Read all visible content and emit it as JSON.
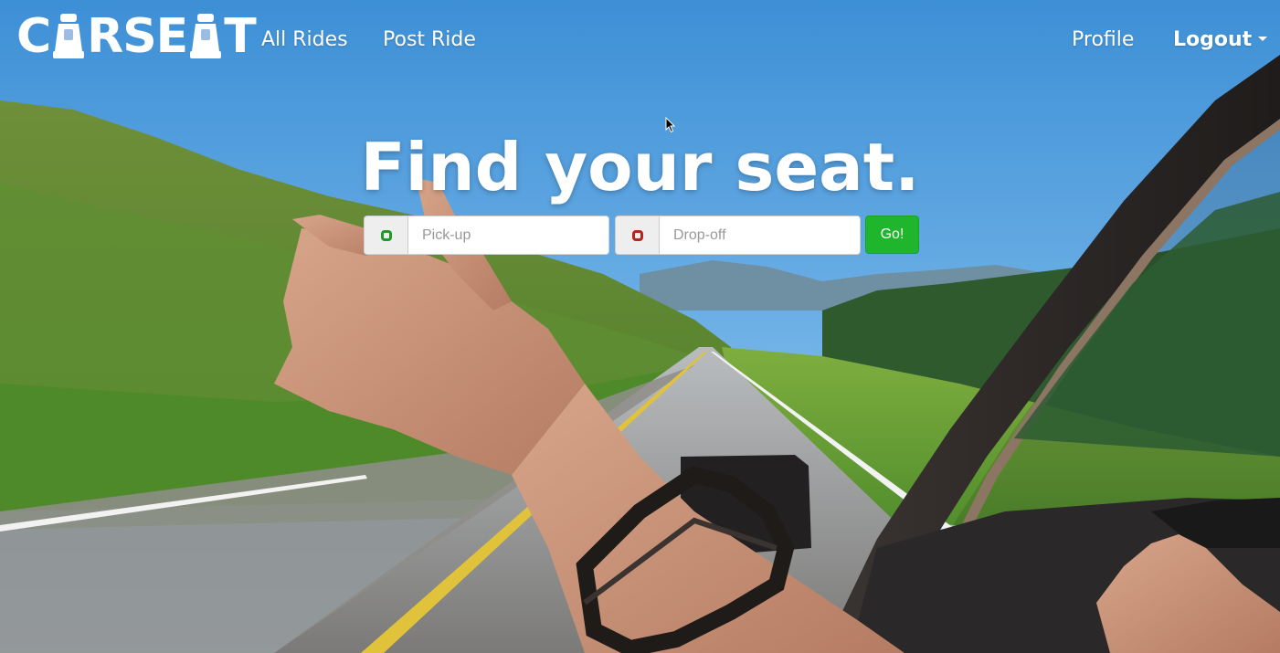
{
  "brand": {
    "name": "CARSEAT",
    "prefix": "C",
    "middle": "RSE",
    "suffix": "T"
  },
  "nav": {
    "links": [
      {
        "label": "All Rides"
      },
      {
        "label": "Post Ride"
      }
    ],
    "profile_label": "Profile",
    "logout_label": "Logout"
  },
  "hero": {
    "title": "Find your seat."
  },
  "search": {
    "pickup": {
      "placeholder": "Pick-up",
      "value": "",
      "icon": "pickup-marker-icon",
      "icon_color": "#1e9a2a"
    },
    "dropoff": {
      "placeholder": "Drop-off",
      "value": "",
      "icon": "dropoff-marker-icon",
      "icon_color": "#b3261e"
    },
    "go_label": "Go!",
    "go_color": "#1fb52c"
  },
  "colors": {
    "nav_text": "#ffffff",
    "title_text": "#ffffff"
  }
}
